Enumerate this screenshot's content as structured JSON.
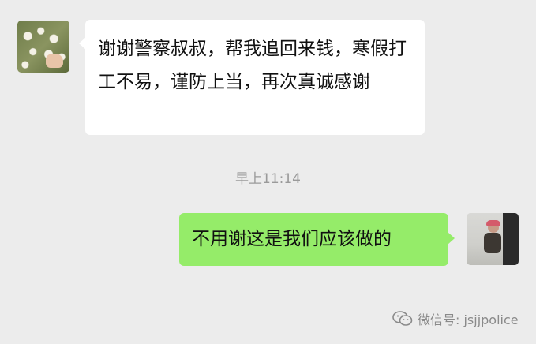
{
  "messages": [
    {
      "side": "left",
      "text": "谢谢警察叔叔，帮我追回来钱，寒假打工不易，谨防上当，再次真诚感谢"
    },
    {
      "side": "right",
      "text": "不用谢这是我们应该做的"
    }
  ],
  "timestamp": "早上11:14",
  "watermark": {
    "text": "微信号: jsjjpolice",
    "icon": "wechat-icon"
  },
  "colors": {
    "background": "#ececec",
    "incoming_bubble": "#ffffff",
    "outgoing_bubble": "#95ec69",
    "timestamp_text": "#9a9a9a"
  }
}
